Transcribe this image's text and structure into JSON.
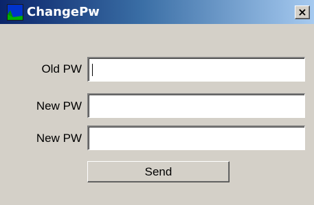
{
  "window": {
    "title": "ChangePw",
    "close_glyph": "×"
  },
  "form": {
    "old_pw_label": "Old PW",
    "old_pw_value": "",
    "new_pw_label": "New PW",
    "new_pw_value": "",
    "confirm_pw_label": "New PW",
    "confirm_pw_value": "",
    "send_label": "Send"
  },
  "colors": {
    "titlebar_start": "#0a246a",
    "titlebar_end": "#a6caf0",
    "face": "#d4d0c8"
  },
  "icons": {
    "app": "app-icon",
    "close": "close-icon"
  }
}
